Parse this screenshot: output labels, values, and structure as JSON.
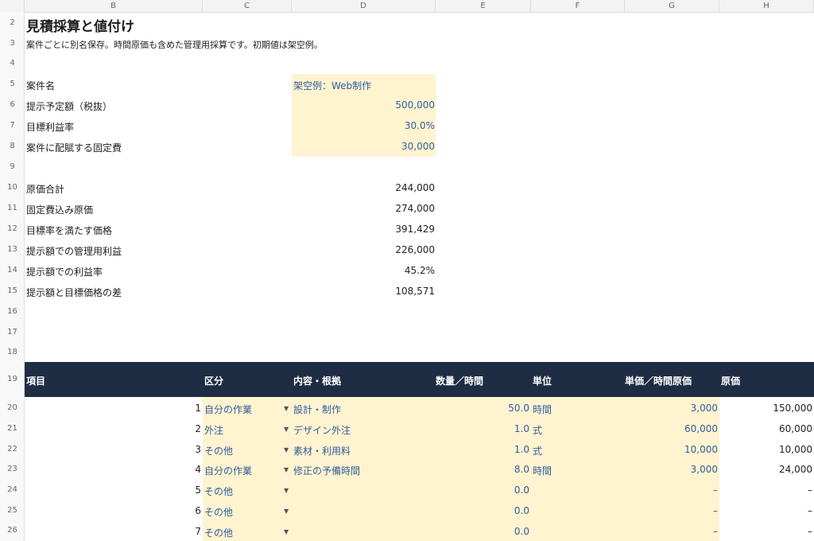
{
  "columns": [
    "B",
    "C",
    "D",
    "E",
    "F",
    "G",
    "H"
  ],
  "rows": [
    "2",
    "3",
    "4",
    "5",
    "6",
    "7",
    "8",
    "9",
    "10",
    "11",
    "12",
    "13",
    "14",
    "15",
    "16",
    "17",
    "18",
    "19",
    "20",
    "21",
    "22",
    "23",
    "24",
    "25",
    "26"
  ],
  "title": "見積採算と値付け",
  "subtitle": "案件ごとに別名保存。時間原価も含めた管理用採算です。初期値は架空例。",
  "inputs": {
    "project_name_label": "案件名",
    "project_name": "架空例：Web制作",
    "quote_label": "提示予定額（税抜）",
    "quote": "500,000",
    "target_margin_label": "目標利益率",
    "target_margin": "30.0%",
    "fixed_cost_label": "案件に配賦する固定費",
    "fixed_cost": "30,000"
  },
  "results": [
    {
      "label": "原価合計",
      "value": "244,000"
    },
    {
      "label": "固定費込み原価",
      "value": "274,000"
    },
    {
      "label": "目標率を満たす価格",
      "value": "391,429"
    },
    {
      "label": "提示額での管理用利益",
      "value": "226,000"
    },
    {
      "label": "提示額での利益率",
      "value": "45.2%"
    },
    {
      "label": "提示額と目標価格の差",
      "value": "108,571"
    }
  ],
  "table": {
    "headers": {
      "item": "項目",
      "category": "区分",
      "detail": "内容・根拠",
      "qty": "数量／時間",
      "unit": "単位",
      "unit_price": "単価／時間原価",
      "cost": "原価"
    },
    "rows": [
      {
        "no": "1",
        "category": "自分の作業",
        "detail": "設計・制作",
        "qty": "50.0",
        "unit": "時間",
        "unit_price": "3,000",
        "cost": "150,000"
      },
      {
        "no": "2",
        "category": "外注",
        "detail": "デザイン外注",
        "qty": "1.0",
        "unit": "式",
        "unit_price": "60,000",
        "cost": "60,000"
      },
      {
        "no": "3",
        "category": "その他",
        "detail": "素材・利用料",
        "qty": "1.0",
        "unit": "式",
        "unit_price": "10,000",
        "cost": "10,000"
      },
      {
        "no": "4",
        "category": "自分の作業",
        "detail": "修正の予備時間",
        "qty": "8.0",
        "unit": "時間",
        "unit_price": "3,000",
        "cost": "24,000"
      },
      {
        "no": "5",
        "category": "その他",
        "detail": "",
        "qty": "0.0",
        "unit": "",
        "unit_price": "–",
        "cost": "–"
      },
      {
        "no": "6",
        "category": "その他",
        "detail": "",
        "qty": "0.0",
        "unit": "",
        "unit_price": "–",
        "cost": "–"
      },
      {
        "no": "7",
        "category": "その他",
        "detail": "",
        "qty": "0.0",
        "unit": "",
        "unit_price": "–",
        "cost": "–"
      }
    ]
  },
  "dropdown_icon": "triangle-down-icon",
  "colors": {
    "input_fill": "#fff3d0",
    "input_text": "#2f5f9e",
    "header_fill": "#1f2d44"
  }
}
